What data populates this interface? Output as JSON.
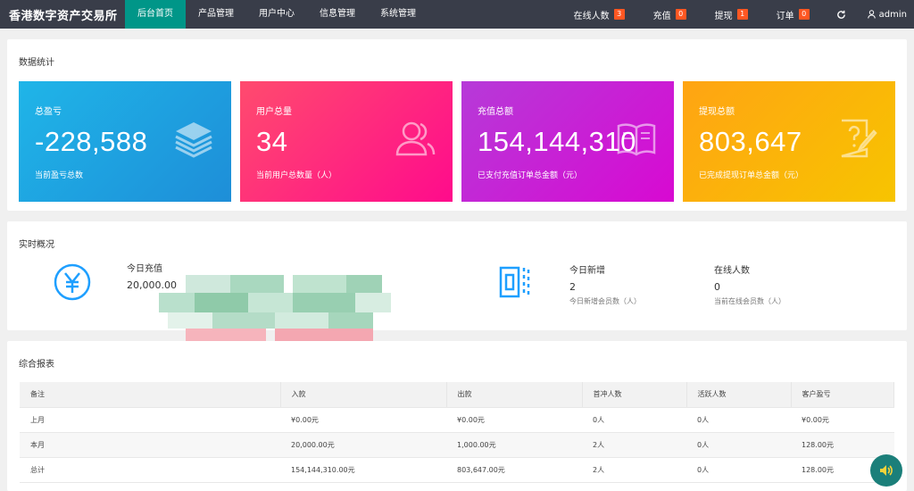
{
  "brand": "香港数字资产交易所",
  "nav": [
    "后台首页",
    "产品管理",
    "用户中心",
    "信息管理",
    "系统管理"
  ],
  "nav_right": {
    "online_label": "在线人数",
    "online_count": "3",
    "recharge_label": "充值",
    "recharge_count": "0",
    "withdraw_label": "提现",
    "withdraw_count": "1",
    "order_label": "订单",
    "order_count": "0",
    "user": "admin"
  },
  "stats": {
    "title": "数据统计",
    "cards": [
      {
        "title": "总盈亏",
        "value": "-228,588",
        "desc": "当前盈亏总数",
        "icon": "layers-icon"
      },
      {
        "title": "用户总量",
        "value": "34",
        "desc": "当前用户总数量（人）",
        "icon": "users-icon"
      },
      {
        "title": "充值总额",
        "value": "154,144,310",
        "desc": "已支付充值订单总金额（元）",
        "icon": "book-icon"
      },
      {
        "title": "提现总额",
        "value": "803,647",
        "desc": "已完成提现订单总金额（元）",
        "icon": "question-edit-icon"
      }
    ]
  },
  "realtime": {
    "title": "实时概况",
    "today_recharge_label": "今日充值",
    "today_recharge_value": "20,000.00",
    "new_label": "今日新增",
    "new_value": "2",
    "new_desc": "今日新增会员数（人）",
    "online_label": "在线人数",
    "online_value": "0",
    "online_desc": "当前在线会员数（人）"
  },
  "report": {
    "title": "综合报表",
    "columns": [
      "备注",
      "入款",
      "出款",
      "首冲人数",
      "活跃人数",
      "客户盈亏"
    ],
    "rows": [
      [
        "上月",
        "¥0.00元",
        "¥0.00元",
        "0人",
        "0人",
        "¥0.00元"
      ],
      [
        "本月",
        "20,000.00元",
        "1,000.00元",
        "2人",
        "0人",
        "128.00元"
      ],
      [
        "总计",
        "154,144,310.00元",
        "803,647.00元",
        "2人",
        "0人",
        "128.00元"
      ]
    ]
  },
  "colors": {
    "topbar": "#393d49",
    "active_nav": "#009688",
    "badge": "#ff5722",
    "icon_blue": "#1e9fff"
  }
}
